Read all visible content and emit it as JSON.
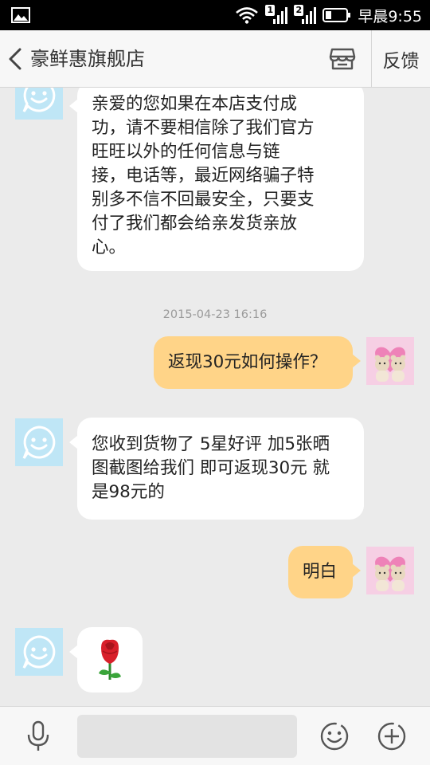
{
  "status_bar": {
    "time": "早晨9:55",
    "sim1": "1",
    "sim2": "2",
    "icons": [
      "gallery-icon",
      "wifi-icon",
      "signal-icon",
      "battery-icon"
    ]
  },
  "header": {
    "title": "豪鲜惠旗舰店",
    "feedback_label": "反馈",
    "icons": [
      "back-chevron-icon",
      "store-icon"
    ]
  },
  "messages": [
    {
      "sender": "shop",
      "text": "亲爱的您如果在本店支付成功，请不要相信除了我们官方旺旺以外的任何信息与链接，电话等，最近网络骗子特别多不信不回最安全，只要支付了我们都会给亲发货亲放心。",
      "lines": [
        "亲爱的您如果在本店支付成",
        "功，请不要相信除了我们官方",
        "旺旺以外的任何信息与链",
        "接，电话等，最近网络骗子特",
        "别多不信不回最安全，只要支",
        "付了我们都会给亲发货亲放",
        "心。"
      ]
    },
    {
      "type": "timestamp",
      "text": "2015-04-23 16:16"
    },
    {
      "sender": "user",
      "text": "返现30元如何操作？"
    },
    {
      "sender": "shop",
      "text": "您收到货物了 5星好评 加5张晒图截图给我们 即可返现30元 就是98元的",
      "lines": [
        "您收到货物了 5星好评 加5张晒",
        "图截图给我们 即可返现30元 就",
        "是98元的"
      ]
    },
    {
      "sender": "user",
      "text": "明白"
    },
    {
      "sender": "shop",
      "type": "emoji",
      "emoji": "rose-emoji"
    }
  ],
  "input_bar": {
    "input_value": "",
    "icons": [
      "microphone-icon",
      "smiley-icon",
      "plus-icon"
    ]
  },
  "colors": {
    "status_bar_bg": "#000000",
    "header_bg": "#f7f7f7",
    "chat_bg": "#ebebeb",
    "shop_bubble": "#ffffff",
    "user_bubble": "#ffd488",
    "bot_avatar_bg": "#bfe6f6",
    "timestamp_text": "#9a9a9a"
  }
}
